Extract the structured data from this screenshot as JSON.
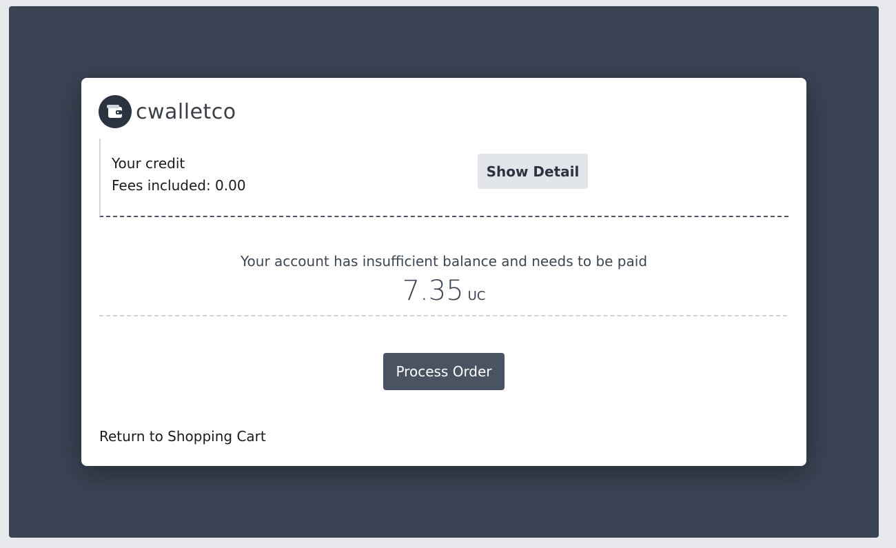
{
  "brand": {
    "name": "cwalletco",
    "logo_icon": "wallet-icon"
  },
  "credit": {
    "title": "Your credit",
    "fees_label": "Fees included: 0.00",
    "show_detail_label": "Show Detail"
  },
  "payment": {
    "notice": "Your account has insufficient balance and needs to be paid",
    "amount": "7.35",
    "unit": "UC"
  },
  "actions": {
    "process_label": "Process Order",
    "return_label": "Return to Shopping Cart"
  },
  "colors": {
    "backdrop": "#3a4354",
    "primary_button": "#4a5361",
    "secondary_button": "#e2e5ea"
  }
}
